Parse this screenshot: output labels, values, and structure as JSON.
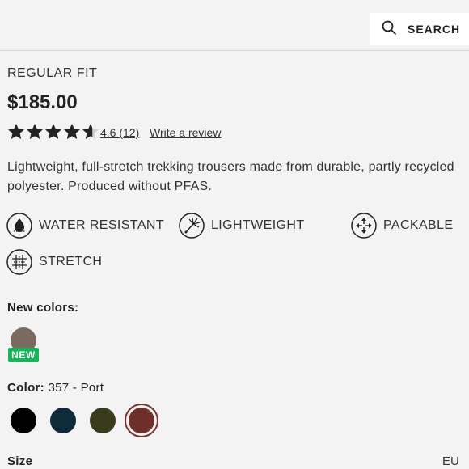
{
  "header": {
    "search_label": "SEARCH",
    "search_icon": "search-icon"
  },
  "product": {
    "fit": "REGULAR FIT",
    "price": "$185.00",
    "rating": {
      "value": 4.6,
      "max": 5,
      "score_text": "4.6",
      "count_text": "(12)",
      "write_review": "Write a review"
    },
    "description": "Lightweight, full-stretch trekking trousers made from durable, partly recycled polyester. Produced without PFAS."
  },
  "features": [
    {
      "icon": "water-resistant-icon",
      "label": "WATER RESISTANT"
    },
    {
      "icon": "lightweight-icon",
      "label": "LIGHTWEIGHT"
    },
    {
      "icon": "packable-icon",
      "label": "PACKABLE"
    },
    {
      "icon": "stretch-icon",
      "label": "STRETCH"
    }
  ],
  "new_colors": {
    "label": "New colors:",
    "badge": "NEW",
    "swatch_color": "#7a6b60"
  },
  "color": {
    "label": "Color:",
    "value": "357 - Port",
    "swatches": [
      "#000000",
      "#0f2a38",
      "#3a3a1c",
      "#6e2e2a"
    ],
    "selected_index": 3
  },
  "size": {
    "label": "Size",
    "unit": "EU"
  }
}
